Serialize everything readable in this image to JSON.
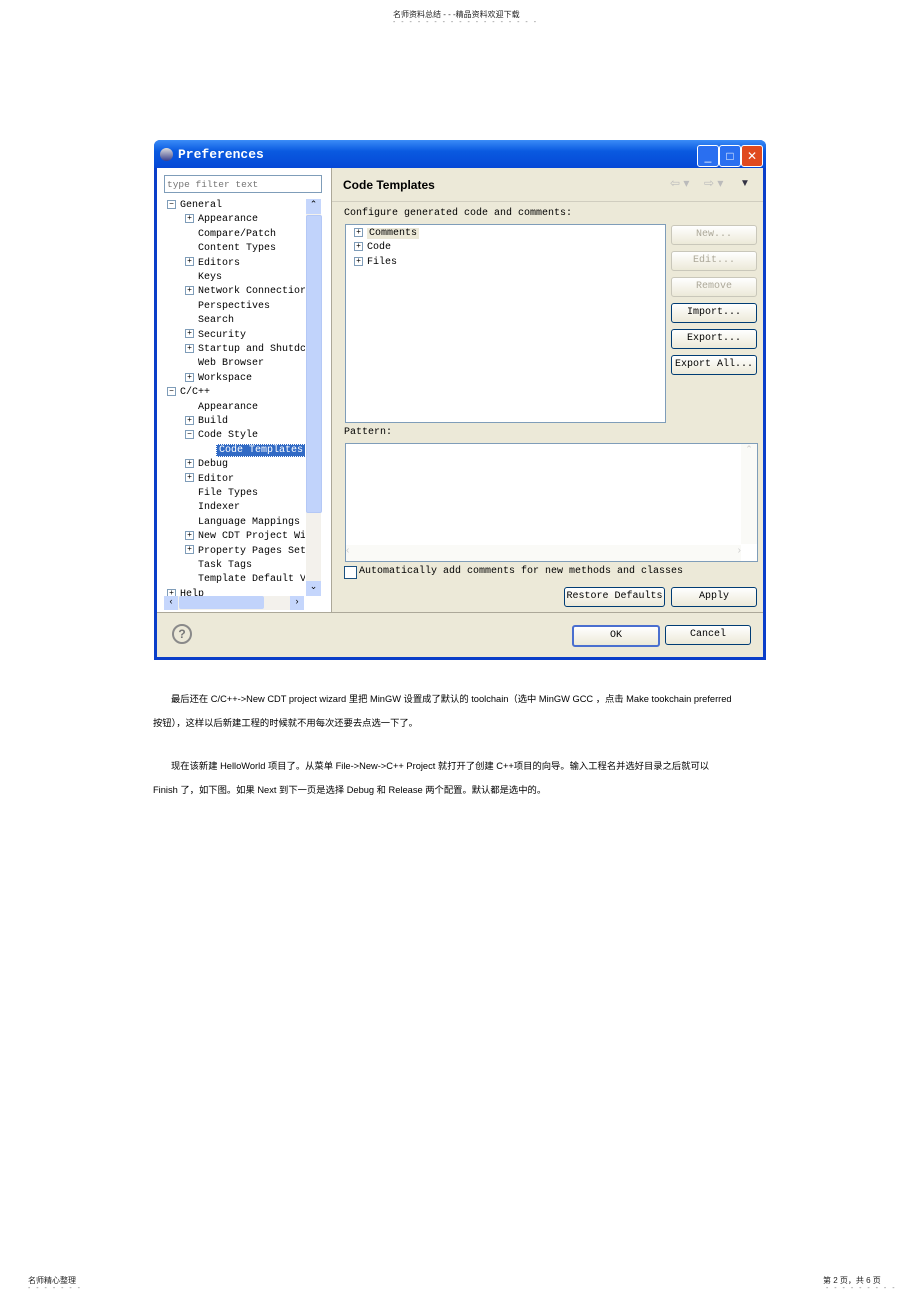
{
  "page_header": "名师资料总结 - - -精品资料欢迎下载",
  "dialog": {
    "title": "Preferences",
    "filter_placeholder": "type filter text",
    "tree": [
      {
        "label": "General",
        "level": 0,
        "expander": "minus"
      },
      {
        "label": "Appearance",
        "level": 1,
        "expander": "plus"
      },
      {
        "label": "Compare/Patch",
        "level": 1,
        "expander": "none"
      },
      {
        "label": "Content Types",
        "level": 1,
        "expander": "none"
      },
      {
        "label": "Editors",
        "level": 1,
        "expander": "plus"
      },
      {
        "label": "Keys",
        "level": 1,
        "expander": "none"
      },
      {
        "label": "Network Connectior",
        "level": 1,
        "expander": "plus"
      },
      {
        "label": "Perspectives",
        "level": 1,
        "expander": "none"
      },
      {
        "label": "Search",
        "level": 1,
        "expander": "none"
      },
      {
        "label": "Security",
        "level": 1,
        "expander": "plus"
      },
      {
        "label": "Startup and Shutdc",
        "level": 1,
        "expander": "plus"
      },
      {
        "label": "Web Browser",
        "level": 1,
        "expander": "none"
      },
      {
        "label": "Workspace",
        "level": 1,
        "expander": "plus"
      },
      {
        "label": "C/C++",
        "level": 0,
        "expander": "minus"
      },
      {
        "label": "Appearance",
        "level": 1,
        "expander": "none"
      },
      {
        "label": "Build",
        "level": 1,
        "expander": "plus"
      },
      {
        "label": "Code Style",
        "level": 1,
        "expander": "minus"
      },
      {
        "label": "Code Templates",
        "level": 2,
        "expander": "none",
        "selected": true
      },
      {
        "label": "Debug",
        "level": 1,
        "expander": "plus"
      },
      {
        "label": "Editor",
        "level": 1,
        "expander": "plus"
      },
      {
        "label": "File Types",
        "level": 1,
        "expander": "none"
      },
      {
        "label": "Indexer",
        "level": 1,
        "expander": "none"
      },
      {
        "label": "Language Mappings",
        "level": 1,
        "expander": "none"
      },
      {
        "label": "New CDT Project Wi",
        "level": 1,
        "expander": "plus"
      },
      {
        "label": "Property Pages Set",
        "level": 1,
        "expander": "plus"
      },
      {
        "label": "Task Tags",
        "level": 1,
        "expander": "none"
      },
      {
        "label": "Template Default V",
        "level": 1,
        "expander": "none"
      },
      {
        "label": "Help",
        "level": 0,
        "expander": "plus"
      }
    ],
    "page_title": "Code Templates",
    "configure_label": "Configure generated code and comments:",
    "template_tree": [
      "Comments",
      "Code",
      "Files"
    ],
    "side_buttons": [
      {
        "label": "New...",
        "enabled": false
      },
      {
        "label": "Edit...",
        "enabled": false
      },
      {
        "label": "Remove",
        "enabled": false
      },
      {
        "label": "Import...",
        "enabled": true
      },
      {
        "label": "Export...",
        "enabled": true
      },
      {
        "label": "Export All...",
        "enabled": true
      }
    ],
    "pattern_label": "Pattern:",
    "checkbox_label": "Automatically add comments for new methods and classes",
    "checkbox_checked": false,
    "restore_defaults": "Restore Defaults",
    "apply": "Apply",
    "ok": "OK",
    "cancel": "Cancel",
    "selection_color": "#316ac5"
  },
  "paragraphs": [
    "最后还在  C/C++->New CDT project wizard   里把 MinGW  设置成了默认的   toolchain（选中  MinGW GCC ，点击  Make tookchain preferred",
    "按钮），这样以后新建工程的时候就不用每次还要去点选一下了。",
    "现在该新建  HelloWorld  项目了。从菜单  File->New->C++   Project 就打开了创建  C++项目的向导。输入工程名并选好目录之后就可以",
    "Finish 了，如下图。如果   Next 到下一页是选择  Debug 和 Release 两个配置。默认都是选中的。"
  ],
  "footer_left": "名师精心整理",
  "footer_right": "第 2 页，共 6 页"
}
